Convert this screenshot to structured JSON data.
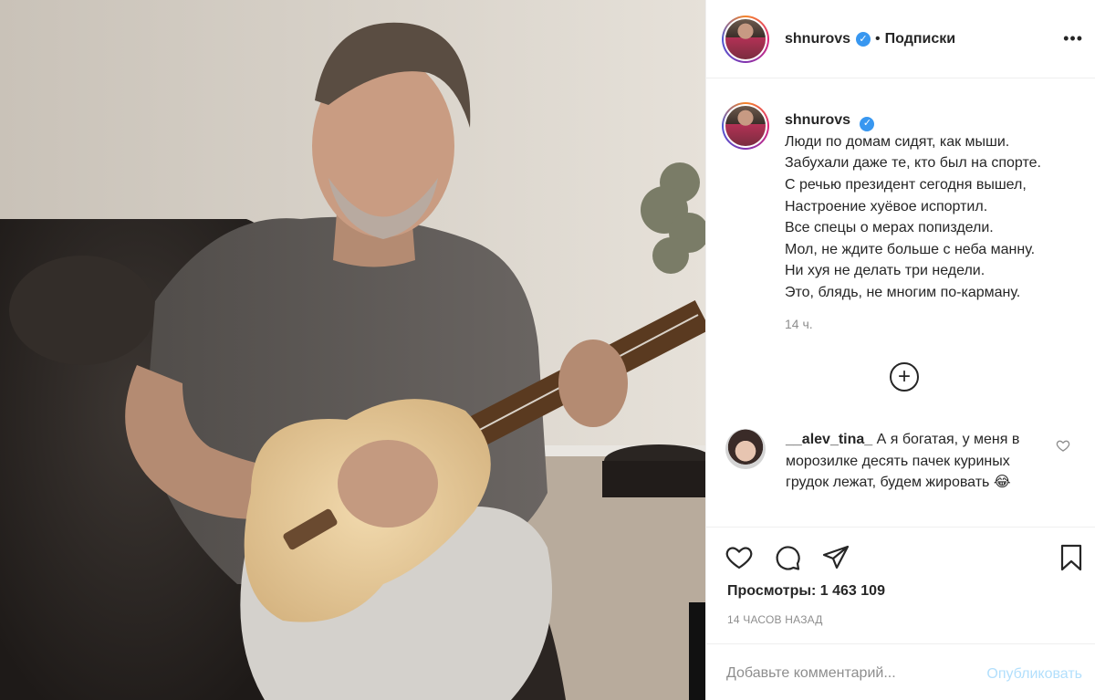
{
  "post": {
    "username": "shnurovs",
    "separator": "•",
    "follow_label": "Подписки",
    "more_label": "•••"
  },
  "caption": {
    "username": "shnurovs",
    "lines": [
      "Люди по домам сидят, как мыши.",
      "Забухали даже те, кто был на спорте.",
      "С речью президент сегодня вышел,",
      "Настроение хуёвое испортил.",
      "Все спецы о мерах попиздели.",
      "Мол, не ждите больше с неба манну.",
      "Ни хуя не делать три недели.",
      "Это, блядь, не многим по-карману."
    ],
    "time": "14 ч."
  },
  "load_more_label": "+",
  "comment": {
    "username": "__alev_tina_",
    "text": "А я богатая, у меня в морозилке десять пачек куриных грудок лежат, будем жировать 😂"
  },
  "stats": {
    "views": "Просмотры: 1 463 109",
    "timestamp": "14 часов назад"
  },
  "composer": {
    "placeholder": "Добавьте комментарий...",
    "post_label": "Опубликовать"
  },
  "icons": [
    "more-icon",
    "verified-icon",
    "plus-circle-icon",
    "heart-icon",
    "comment-icon",
    "share-icon",
    "bookmark-icon"
  ],
  "colors": {
    "verified": "#3897f0",
    "muted": "#8e8e8e",
    "post_disabled": "#b2dffc",
    "text": "#262626"
  }
}
